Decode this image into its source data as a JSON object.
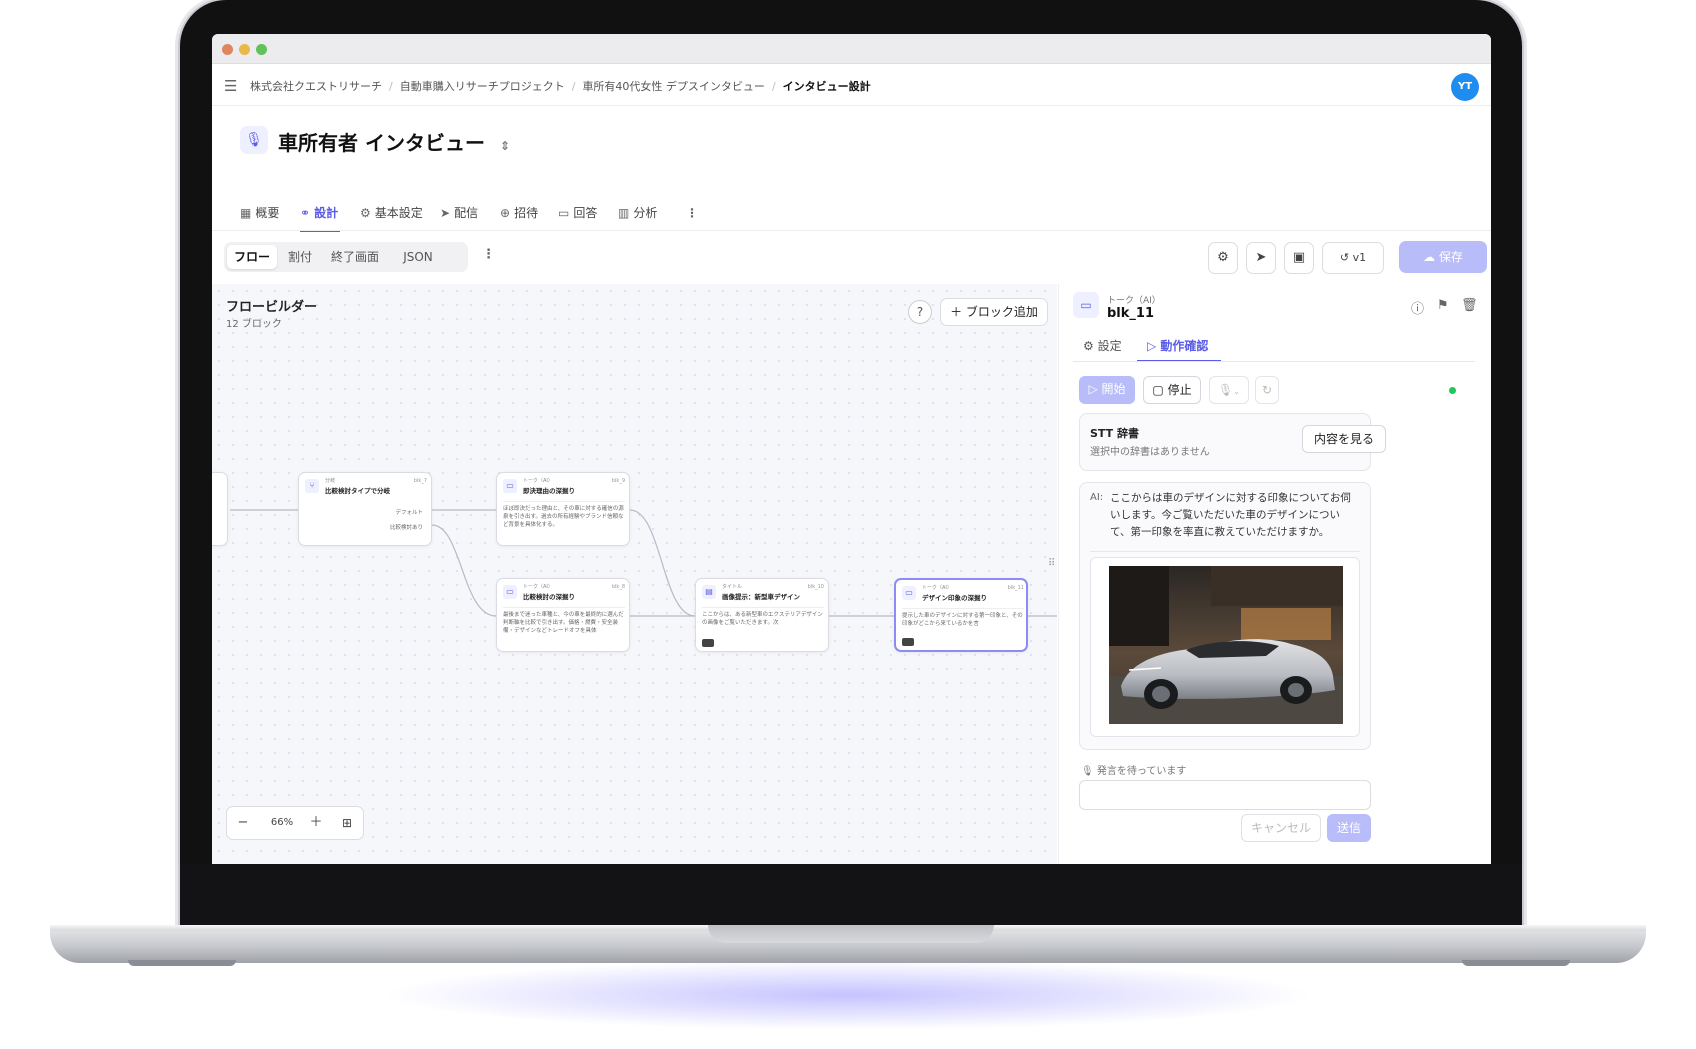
{
  "breadcrumb": [
    "株式会社クエストリサーチ",
    "自動車購入リサーチプロジェクト",
    "車所有40代女性 デプスインタビュー"
  ],
  "breadcrumb_current": "インタビュー設計",
  "avatar_initials": "YT",
  "page_title": "車所有者 インタビュー",
  "tabs": [
    {
      "label": "概要",
      "icon": "grid-icon"
    },
    {
      "label": "設計",
      "icon": "design-icon"
    },
    {
      "label": "基本設定",
      "icon": "gear-icon"
    },
    {
      "label": "配信",
      "icon": "send-icon"
    },
    {
      "label": "招待",
      "icon": "user-plus-icon"
    },
    {
      "label": "回答",
      "icon": "message-icon"
    },
    {
      "label": "分析",
      "icon": "bar-chart-icon"
    }
  ],
  "active_tab": "設計",
  "segments": [
    "フロー",
    "割付",
    "終了画面",
    "JSON"
  ],
  "active_segment": "フロー",
  "toolbar": {
    "version": "v1",
    "save_label": "保存"
  },
  "canvas": {
    "title": "フロービルダー",
    "count": "12 ブロック",
    "add_block": "ブロック追加",
    "zoom": "66%"
  },
  "nodes": [
    {
      "kind": "分岐",
      "id": "blk_7",
      "title": "比較検討タイプで分岐",
      "body": "",
      "branches": [
        "デフォルト",
        "比較検討あり"
      ]
    },
    {
      "kind": "トーク（AI）",
      "id": "blk_9",
      "title": "即決理由の深掘り",
      "body": "ほぼ即決だった理由と、その車に対する確信の源泉を引き出す。過去の所有経験やブランド信頼など背景を具体化する。"
    },
    {
      "kind": "トーク（AI）",
      "id": "blk_8",
      "title": "比較検討の深掘り",
      "body": "最後まで迷った車種と、今の車を最終的に選んだ判断軸を比較で引き出す。価格・燃費・安全装備・デザインなどトレードオフを具体"
    },
    {
      "kind": "タイトル",
      "id": "blk_10",
      "title": "画像提示：新型車デザイン",
      "body": "ここからは、ある新型車のエクステリアデザインの画像をご覧いただきます。次"
    },
    {
      "kind": "トーク（AI）",
      "id": "blk_11",
      "title": "デザイン印象の深掘り",
      "body": "提示した車のデザインに対する第一印象と、その印象がどこから来ているかを言"
    }
  ],
  "panel": {
    "kind": "トーク（AI）",
    "id": "blk_11",
    "tabs": [
      "設定",
      "動作確認"
    ],
    "active_tab": "動作確認",
    "start_label": "開始",
    "stop_label": "停止",
    "stt_title": "STT 辞書",
    "stt_desc": "選択中の辞書はありません",
    "stt_view": "内容を見る",
    "ai_prefix": "AI:",
    "ai_message": "ここからは車のデザインに対する印象についてお伺いします。今ご覧いただいた車のデザインについて、第一印象を率直に教えていただけますか。",
    "waiting": "発言を待っています",
    "cancel_label": "キャンセル",
    "send_label": "送信"
  },
  "colors": {
    "accent": "#5b5ce6",
    "accent_light": "#b8bcf8",
    "avatar": "#1f8cf0",
    "status_online": "#22c55e"
  }
}
